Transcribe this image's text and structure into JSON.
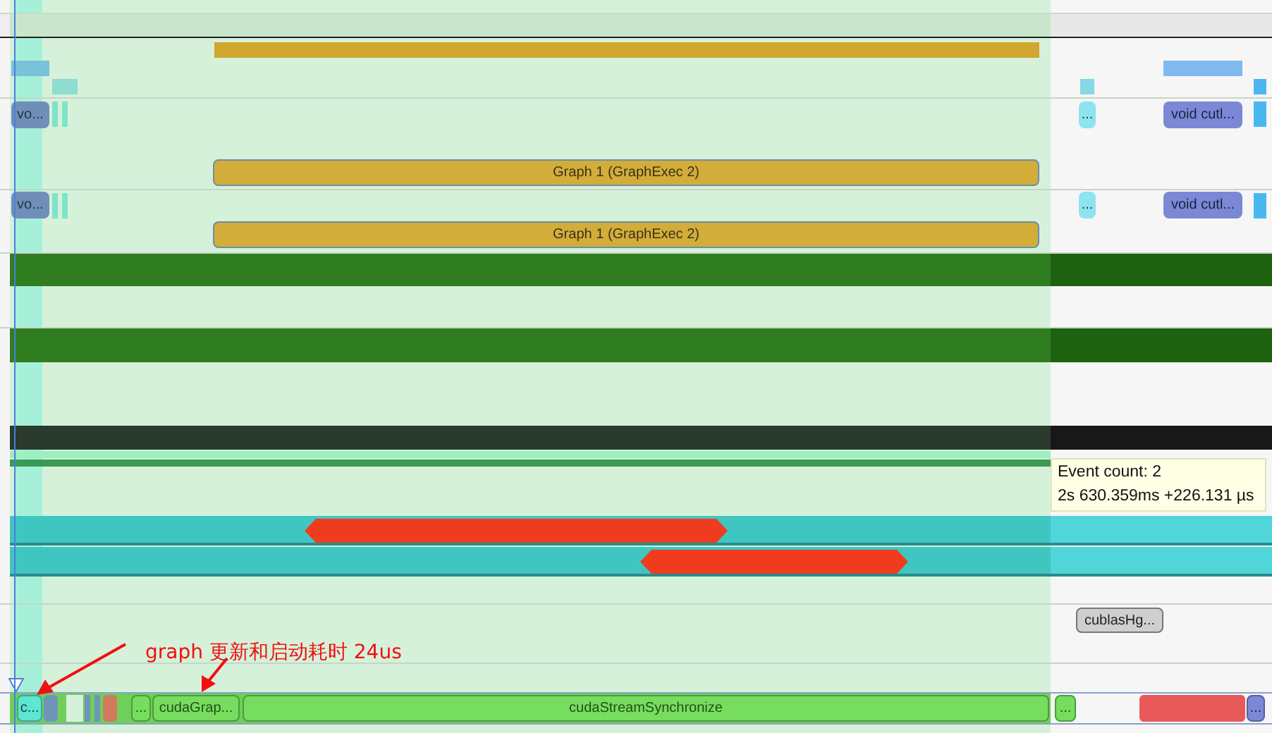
{
  "kernel_rows": [
    {
      "items": [
        {
          "label": "vo..."
        },
        {
          "label": "..."
        },
        {
          "label": "void cutl..."
        }
      ],
      "graph": {
        "label": "Graph 1 (GraphExec 2)"
      }
    },
    {
      "items": [
        {
          "label": "vo..."
        },
        {
          "label": "..."
        },
        {
          "label": "void cutl..."
        }
      ],
      "graph": {
        "label": "Graph 1 (GraphExec 2)"
      }
    }
  ],
  "tooltip": {
    "lines": [
      "Event count: 2",
      "2s 630.359ms +226.131 µs"
    ]
  },
  "cublas_call": {
    "label": "cublasHg..."
  },
  "annotation": {
    "text": "graph 更新和启动耗时 24us"
  },
  "api_row": {
    "items": [
      {
        "label": "c...",
        "kind": "highlight"
      },
      {
        "label": "...",
        "kind": "call"
      },
      {
        "label": "cudaGrap...",
        "kind": "call"
      },
      {
        "label": "cudaStreamSynchronize",
        "kind": "call"
      },
      {
        "label": "...",
        "kind": "call"
      },
      {
        "label": "...",
        "kind": "kernel"
      }
    ]
  }
}
